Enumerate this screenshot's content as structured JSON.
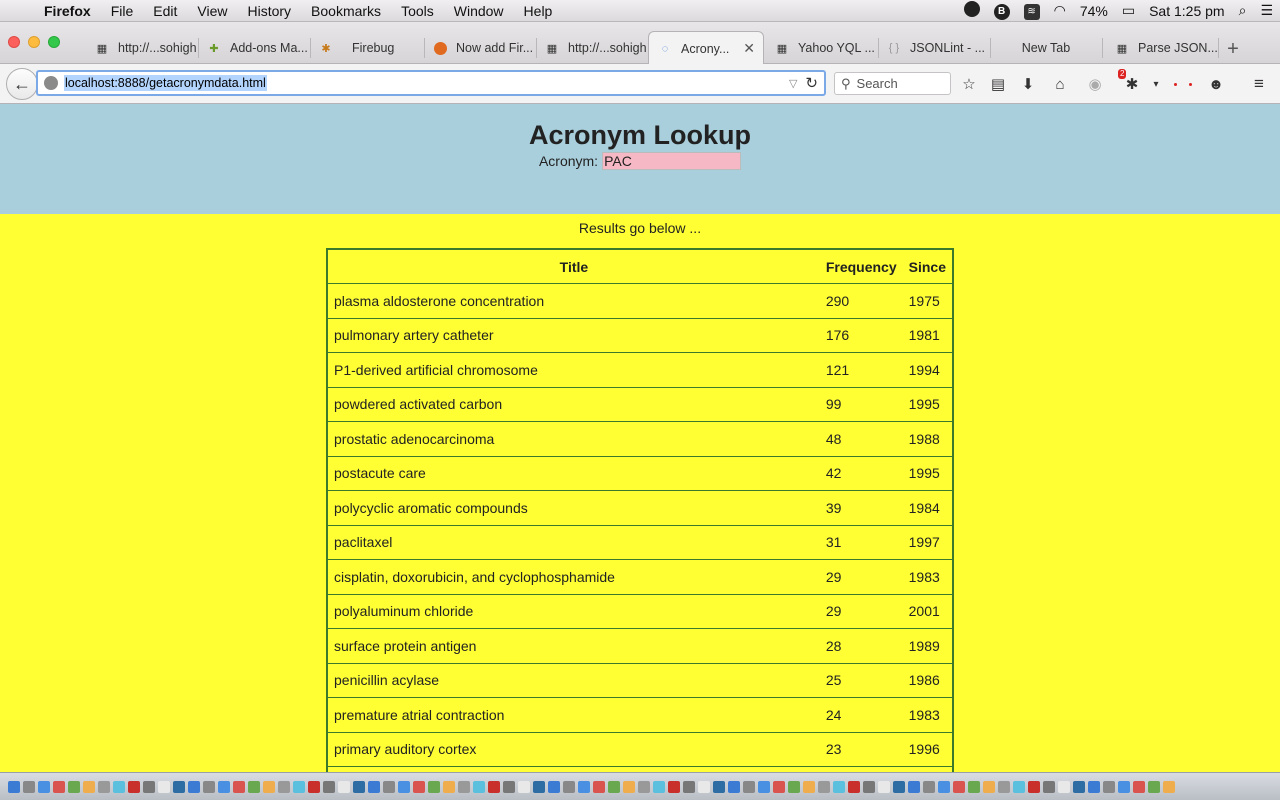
{
  "menubar": {
    "app_name": "Firefox",
    "items": [
      "File",
      "Edit",
      "View",
      "History",
      "Bookmarks",
      "Tools",
      "Window",
      "Help"
    ],
    "battery": "74%",
    "clock": "Sat 1:25 pm"
  },
  "tabs": [
    {
      "label": "http://...sohigh",
      "icon": "page-icon",
      "active": false
    },
    {
      "label": "Add-ons Ma...",
      "icon": "puzzle-icon",
      "active": false
    },
    {
      "label": "Firebug",
      "icon": "bug-icon",
      "active": false
    },
    {
      "label": "Now add Fir...",
      "icon": "firefox-icon",
      "active": false
    },
    {
      "label": "http://...sohigh",
      "icon": "page-icon",
      "active": false
    },
    {
      "label": "Acrony...",
      "icon": "loading-icon",
      "active": true
    },
    {
      "label": "Yahoo YQL ...",
      "icon": "page-icon",
      "active": false
    },
    {
      "label": "JSONLint - ...",
      "icon": "braces-icon",
      "active": false
    },
    {
      "label": "New Tab",
      "icon": "",
      "active": false
    },
    {
      "label": "Parse JSON...",
      "icon": "page-icon",
      "active": false
    }
  ],
  "navbar": {
    "url": "localhost:8888/getacronymdata.html",
    "search_placeholder": "Search",
    "notification_count": "2"
  },
  "page": {
    "title": "Acronym Lookup",
    "acronym_label": "Acronym:",
    "acronym_value": "PAC",
    "results_note": "Results go below ...",
    "table": {
      "headers": [
        "Title",
        "Frequency",
        "Since"
      ],
      "rows": [
        [
          "plasma aldosterone concentration",
          "290",
          "1975"
        ],
        [
          "pulmonary artery catheter",
          "176",
          "1981"
        ],
        [
          "P1-derived artificial chromosome",
          "121",
          "1994"
        ],
        [
          "powdered activated carbon",
          "99",
          "1995"
        ],
        [
          "prostatic adenocarcinoma",
          "48",
          "1988"
        ],
        [
          "postacute care",
          "42",
          "1995"
        ],
        [
          "polycyclic aromatic compounds",
          "39",
          "1984"
        ],
        [
          "paclitaxel",
          "31",
          "1997"
        ],
        [
          "cisplatin, doxorubicin, and cyclophosphamide",
          "29",
          "1983"
        ],
        [
          "polyaluminum chloride",
          "29",
          "2001"
        ],
        [
          "surface protein antigen",
          "28",
          "1989"
        ],
        [
          "penicillin acylase",
          "25",
          "1986"
        ],
        [
          "premature atrial contraction",
          "24",
          "1983"
        ],
        [
          "primary auditory cortex",
          "23",
          "1996"
        ]
      ]
    }
  },
  "colors": {
    "header_bg": "#a9cfdc",
    "page_bg": "#ffff33",
    "input_bg": "#f6b8c4",
    "table_border": "#3a7a2a"
  }
}
